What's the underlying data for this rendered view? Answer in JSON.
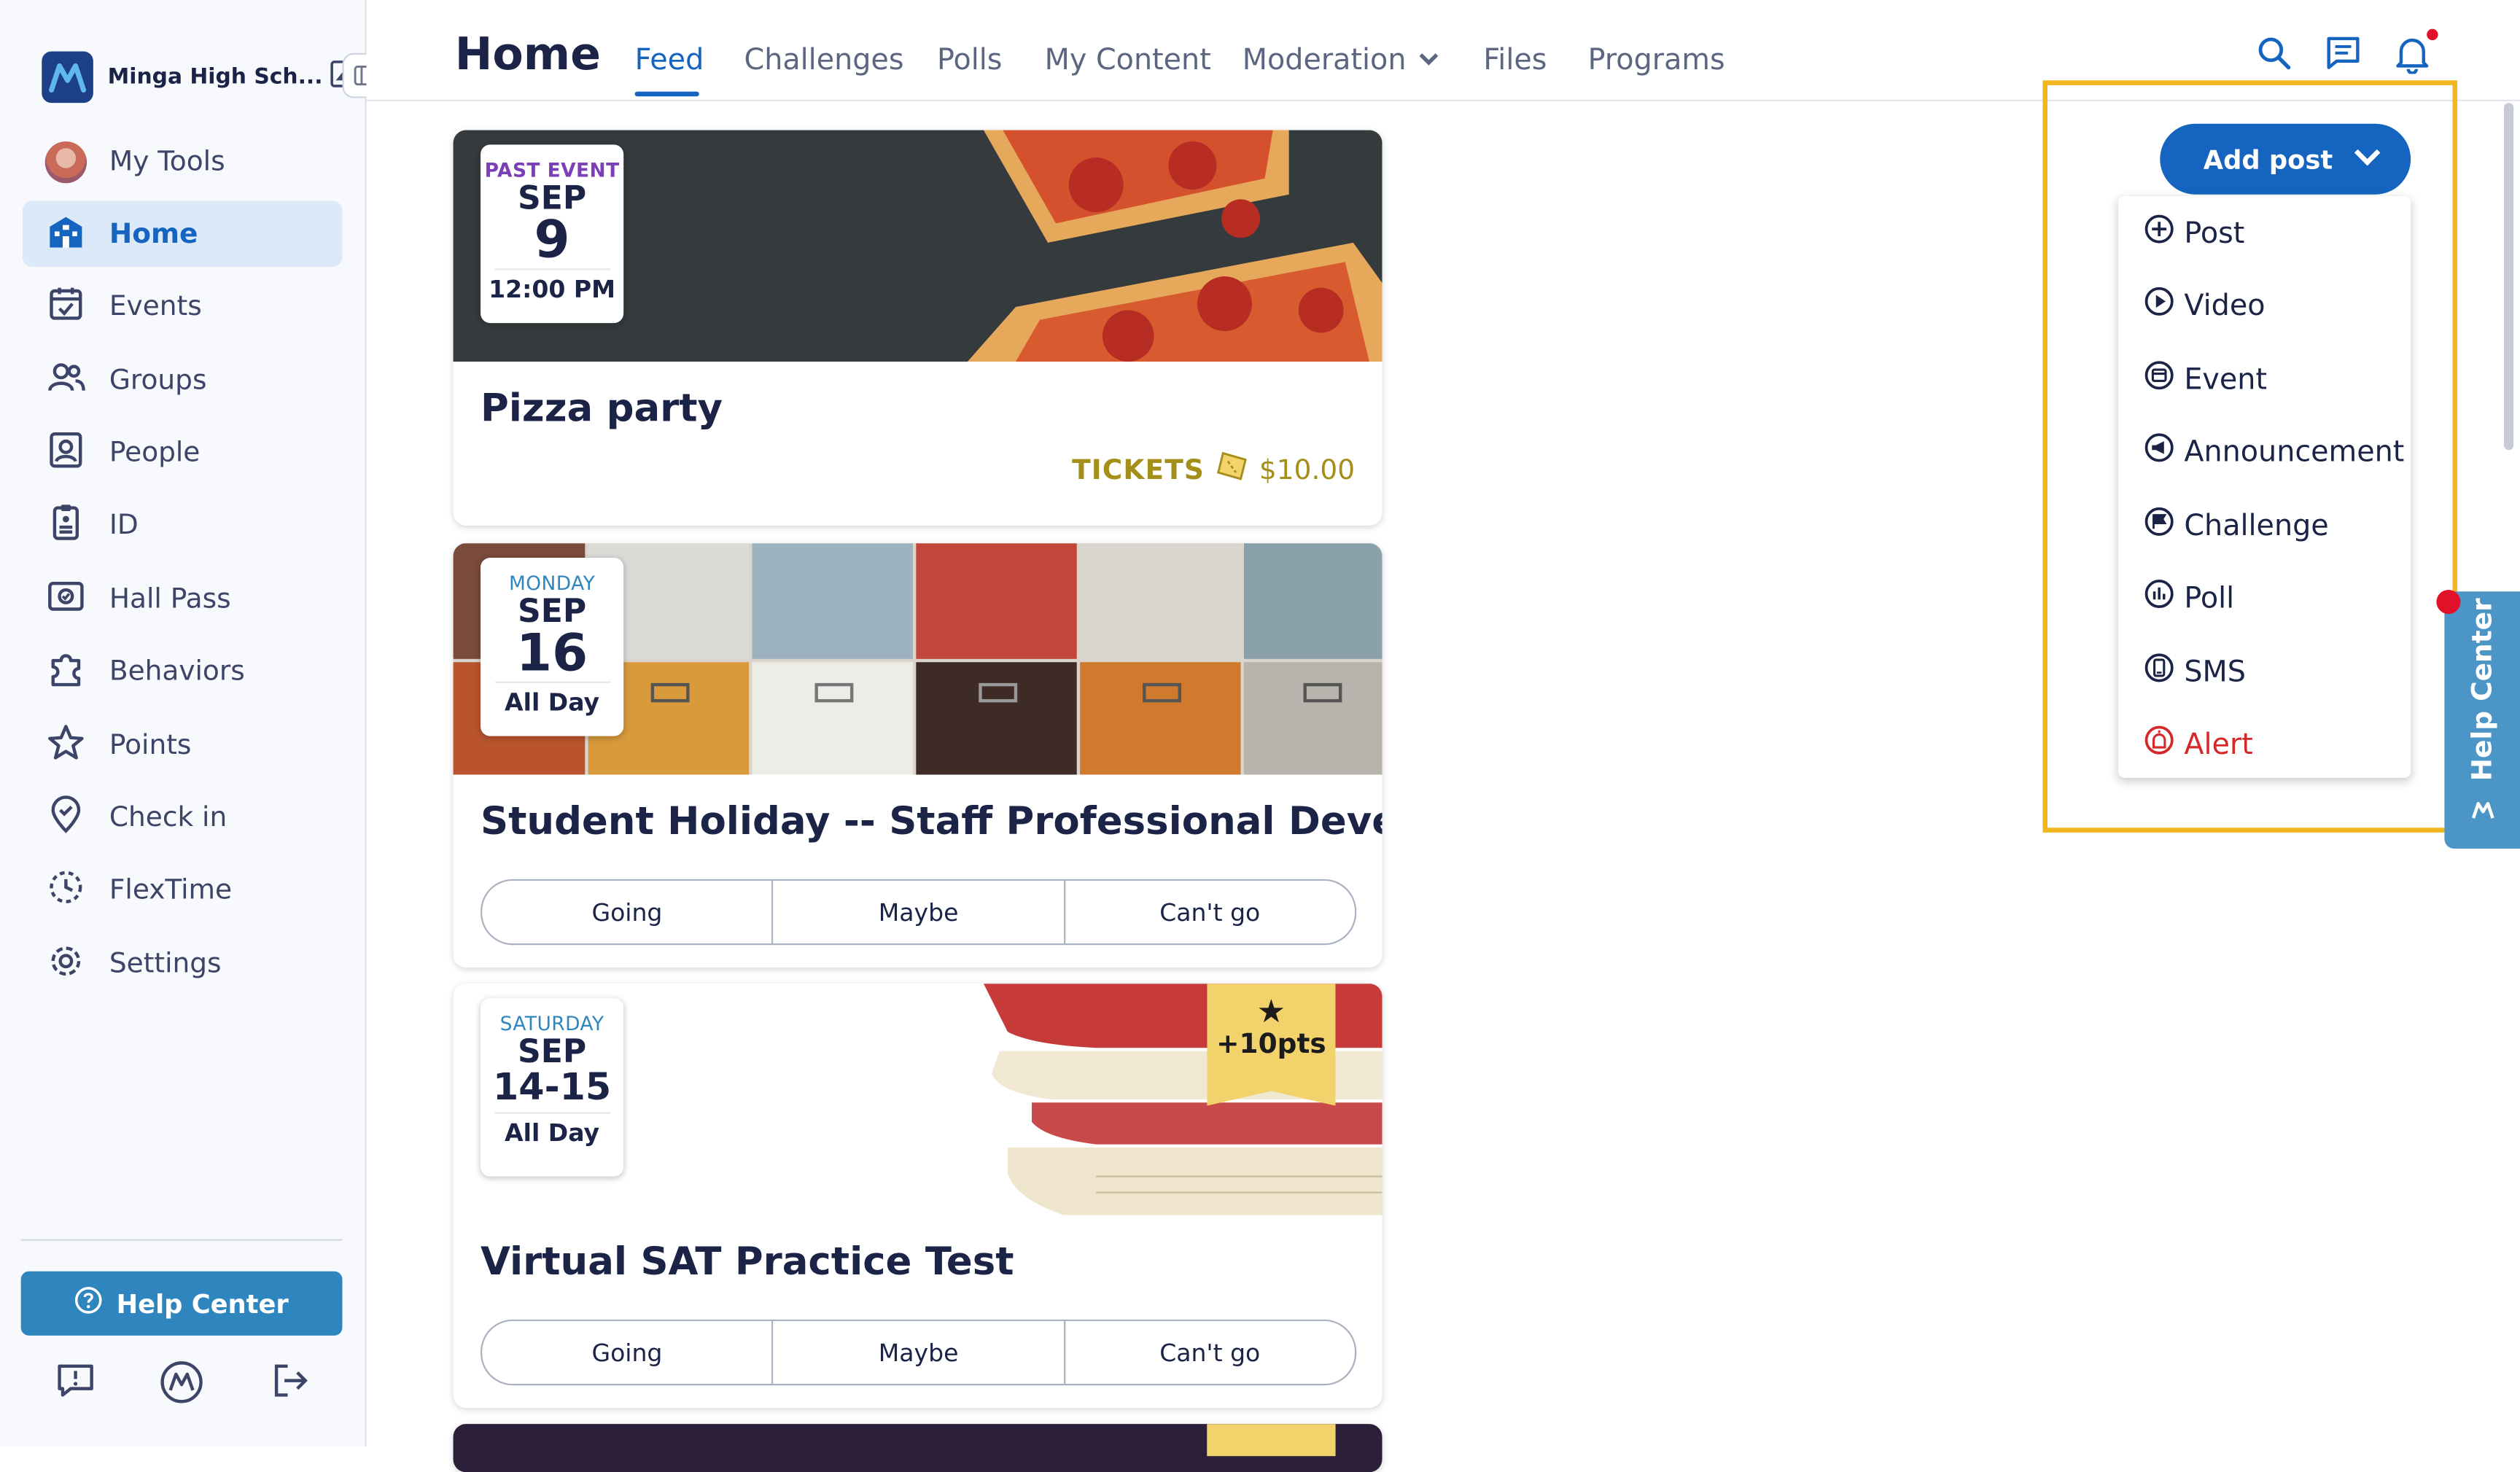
{
  "sidebar": {
    "school_name": "Minga High Sch...",
    "items": [
      {
        "label": "My Tools",
        "icon": "avatar"
      },
      {
        "label": "Home",
        "icon": "home-icon",
        "active": true
      },
      {
        "label": "Events",
        "icon": "calendar-icon"
      },
      {
        "label": "Groups",
        "icon": "groups-icon"
      },
      {
        "label": "People",
        "icon": "people-icon"
      },
      {
        "label": "ID",
        "icon": "id-icon"
      },
      {
        "label": "Hall Pass",
        "icon": "hall-pass-icon"
      },
      {
        "label": "Behaviors",
        "icon": "behaviors-icon"
      },
      {
        "label": "Points",
        "icon": "star-icon"
      },
      {
        "label": "Check in",
        "icon": "check-in-icon"
      },
      {
        "label": "FlexTime",
        "icon": "flextime-icon"
      },
      {
        "label": "Settings",
        "icon": "gear-icon"
      }
    ],
    "help_button": "Help Center"
  },
  "header": {
    "title": "Home",
    "tabs": [
      {
        "label": "Feed",
        "active": true
      },
      {
        "label": "Challenges"
      },
      {
        "label": "Polls"
      },
      {
        "label": "My Content"
      },
      {
        "label": "Moderation"
      },
      {
        "label": "Files"
      },
      {
        "label": "Programs"
      }
    ]
  },
  "feed": [
    {
      "badge_top": "PAST EVENT",
      "month": "SEP",
      "day": "9",
      "time": "12:00 PM",
      "title": "Pizza party",
      "tickets_label": "TICKETS",
      "price": "$10.00"
    },
    {
      "badge_top": "MONDAY",
      "month": "SEP",
      "day": "16",
      "time": "All Day",
      "title": "Student Holiday -- Staff Professional Develop...",
      "rsvp": [
        "Going",
        "Maybe",
        "Can't go"
      ]
    },
    {
      "badge_top": "SATURDAY",
      "month": "SEP",
      "day": "14-15",
      "time": "All Day",
      "title": "Virtual SAT Practice Test",
      "points": "+10pts",
      "rsvp": [
        "Going",
        "Maybe",
        "Can't go"
      ]
    }
  ],
  "add_post": {
    "button_label": "Add post",
    "menu": [
      {
        "label": "Post",
        "icon": "plus-circle-icon"
      },
      {
        "label": "Video",
        "icon": "play-circle-icon"
      },
      {
        "label": "Event",
        "icon": "calendar-circle-icon"
      },
      {
        "label": "Announcement",
        "icon": "megaphone-circle-icon"
      },
      {
        "label": "Challenge",
        "icon": "flag-circle-icon"
      },
      {
        "label": "Poll",
        "icon": "chart-circle-icon"
      },
      {
        "label": "SMS",
        "icon": "phone-circle-icon"
      },
      {
        "label": "Alert",
        "icon": "alert-circle-icon"
      }
    ]
  },
  "help_tab": {
    "label": "Help Center"
  },
  "colors": {
    "accent": "#1565c0",
    "highlight": "#f2b61f",
    "alert": "#d62828",
    "help": "#2f86bf",
    "ticket": "#a48f1b"
  }
}
